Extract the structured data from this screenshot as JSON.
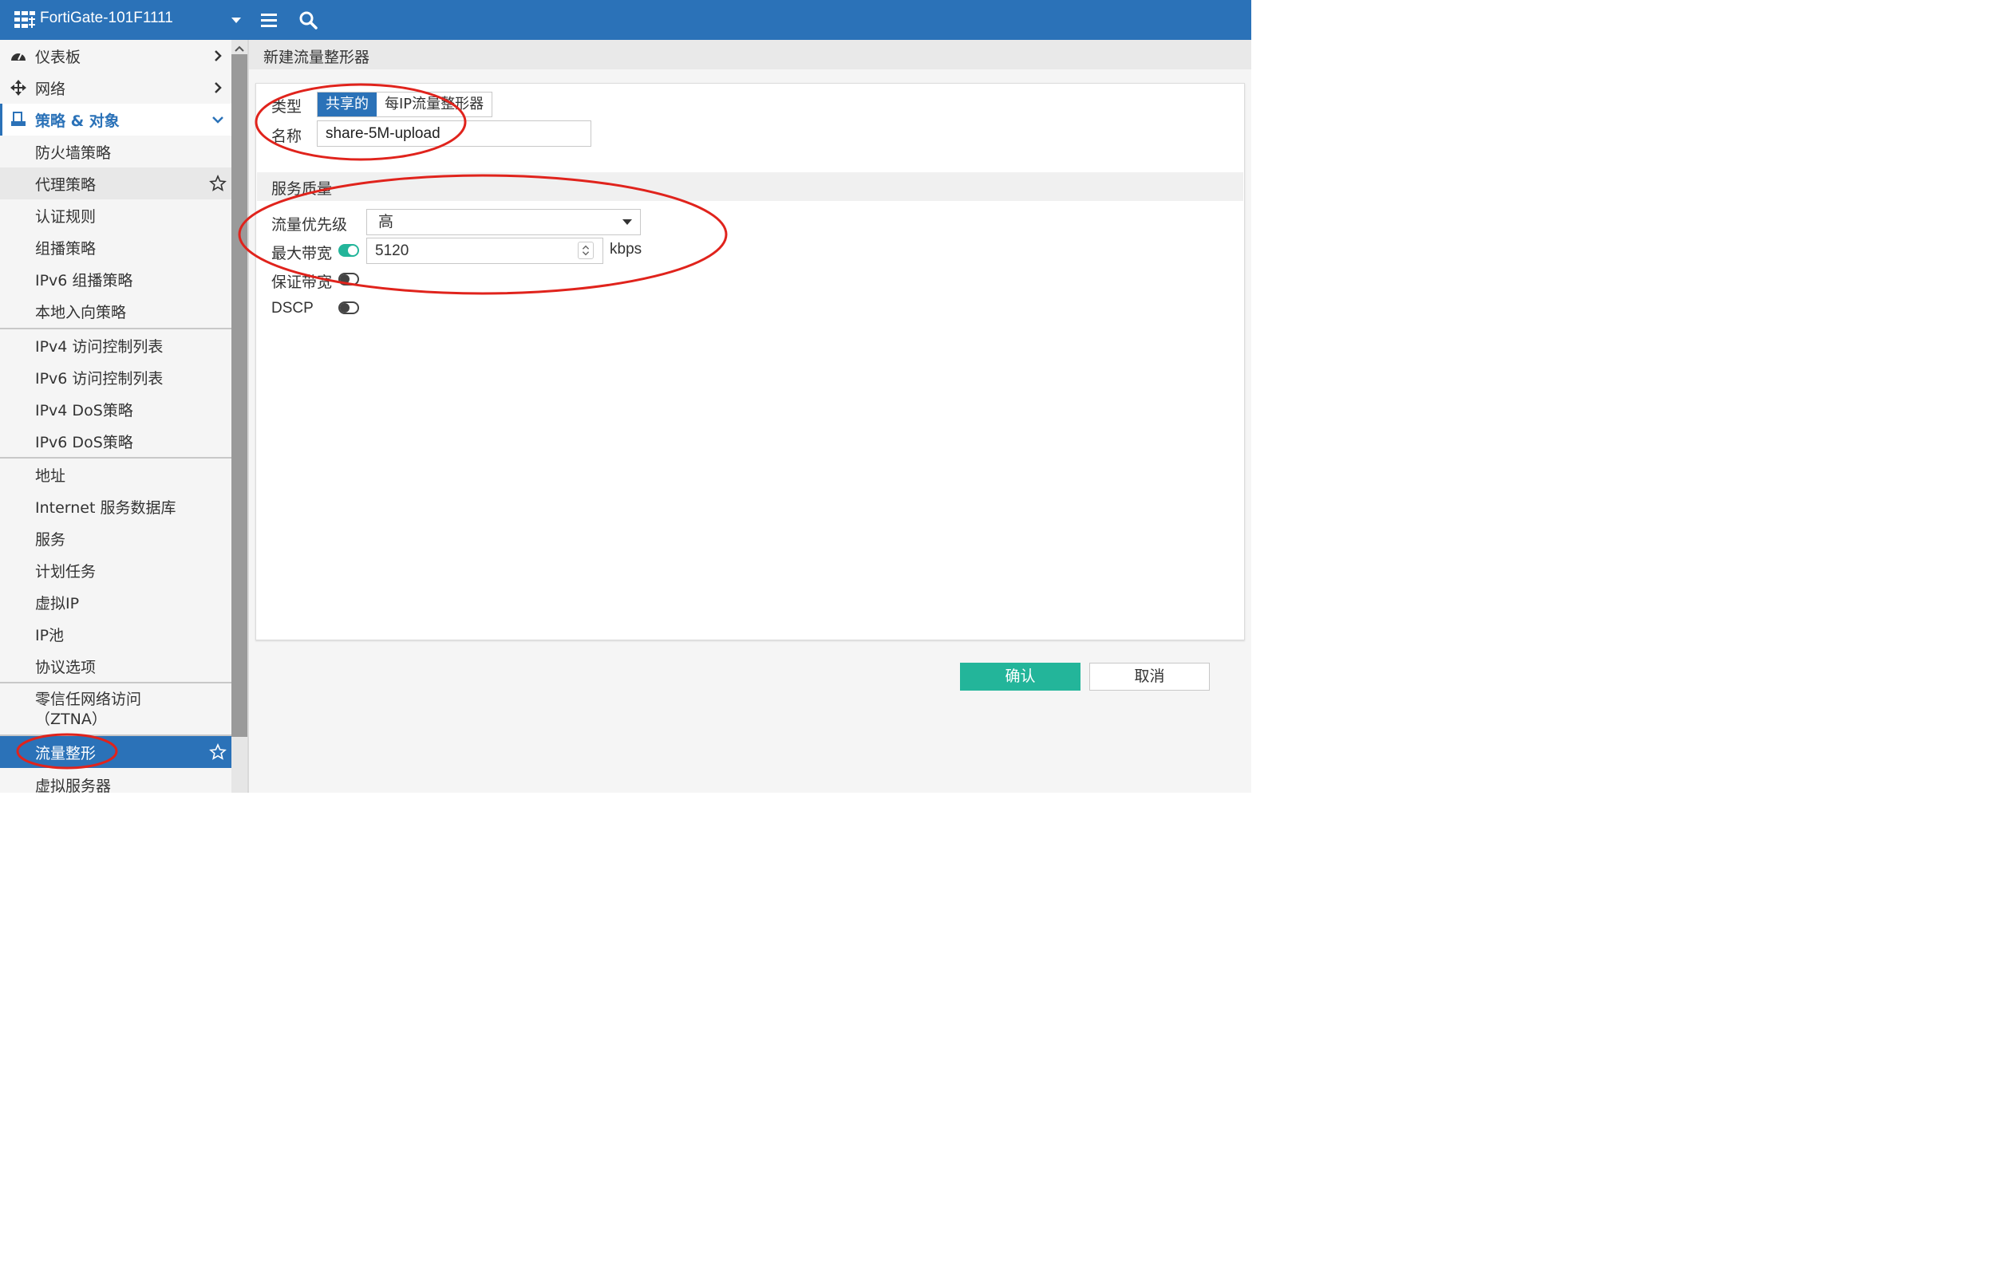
{
  "topbar": {
    "hostname": "FortiGate-101F1111",
    "menu_icon": "hamburger-icon",
    "search_icon": "search-icon"
  },
  "sidebar": {
    "dashboard": "仪表板",
    "network": "网络",
    "policy_objects": "策略 & 对象",
    "items": {
      "firewall_policy": "防火墙策略",
      "proxy_policy": "代理策略",
      "auth_rules": "认证规则",
      "multicast_policy": "组播策略",
      "ipv6_multicast_policy": "IPv6 组播策略",
      "local_in_policy": "本地入向策略",
      "ipv4_acl": "IPv4 访问控制列表",
      "ipv6_acl": "IPv6 访问控制列表",
      "ipv4_dos": "IPv4 DoS策略",
      "ipv6_dos": "IPv6 DoS策略",
      "addresses": "地址",
      "internet_service_db": "Internet 服务数据库",
      "services": "服务",
      "schedules": "计划任务",
      "virtual_ip": "虚拟IP",
      "ip_pools": "IP池",
      "protocol_options": "协议选项",
      "ztna_line1": "零信任网络访问",
      "ztna_line2": "（ZTNA）",
      "traffic_shaping": "流量整形",
      "virtual_servers": "虚拟服务器"
    }
  },
  "page": {
    "title": "新建流量整形器"
  },
  "form": {
    "type_label": "类型",
    "type_options": [
      "共享的",
      "每IP流量整形器"
    ],
    "type_selected": "共享的",
    "name_label": "名称",
    "name_value": "share-5M-upload",
    "qos_section": "服务质量",
    "priority_label": "流量优先级",
    "priority_value": "高",
    "max_bw_label": "最大带宽",
    "max_bw_enabled": true,
    "max_bw_value": "5120",
    "max_bw_unit": "kbps",
    "guaranteed_bw_label": "保证带宽",
    "guaranteed_bw_enabled": false,
    "dscp_label": "DSCP",
    "dscp_enabled": false
  },
  "buttons": {
    "ok": "确认",
    "cancel": "取消"
  },
  "colors": {
    "brand": "#2b72b8",
    "accent": "#23b59a",
    "annotation": "#e0231c"
  }
}
